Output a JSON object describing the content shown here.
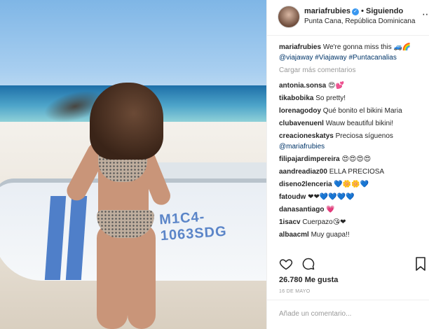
{
  "post": {
    "username": "mariafrubies",
    "follow_label": "Siguiendo",
    "location": "Punta Cana, República Dominicana",
    "boat_text": "M1C4-1063SDG"
  },
  "caption": {
    "username": "mariafrubies",
    "text": "We're gonna miss this 🚙🌈",
    "hashtags": "@viajaway #Viajaway #Puntacanalias"
  },
  "load_more_label": "Cargar más comentarios",
  "comments": [
    {
      "user": "antonia.sonsa",
      "text": "😍💕"
    },
    {
      "user": "tikabobika",
      "text": "So pretty!"
    },
    {
      "user": "lorenagodoy",
      "text": "Qué bonito el bikini Maria"
    },
    {
      "user": "clubavenuenl",
      "text": "Wauw beautiful bikini!"
    },
    {
      "user": "creacioneskatys",
      "text": "Preciosa síguenos",
      "mention": "@mariafrubies"
    },
    {
      "user": "filipajardimpereira",
      "text": "😍😍😍😍"
    },
    {
      "user": "aandreadiaz00",
      "text": "ELLA PRECIOSA"
    },
    {
      "user": "diseno2lenceria",
      "text": "💙🌼🌼💙"
    },
    {
      "user": "fatoudw",
      "text": "❤❤💙💙💙💙"
    },
    {
      "user": "danasantiago",
      "text": "💗"
    },
    {
      "user": "1isacv",
      "text": "Cuerpazo😘❤"
    },
    {
      "user": "albaacml",
      "text": "Muy guapa!!"
    }
  ],
  "likes": "26.780 Me gusta",
  "date": "16 DE MAYO",
  "add_comment_placeholder": "Añade un comentario...",
  "icons": {
    "like": "heart-icon",
    "comment": "comment-bubble-icon",
    "save": "bookmark-icon",
    "more": "more-options-icon"
  },
  "colors": {
    "link": "#003569",
    "muted": "#999999",
    "verified": "#3897f0"
  }
}
